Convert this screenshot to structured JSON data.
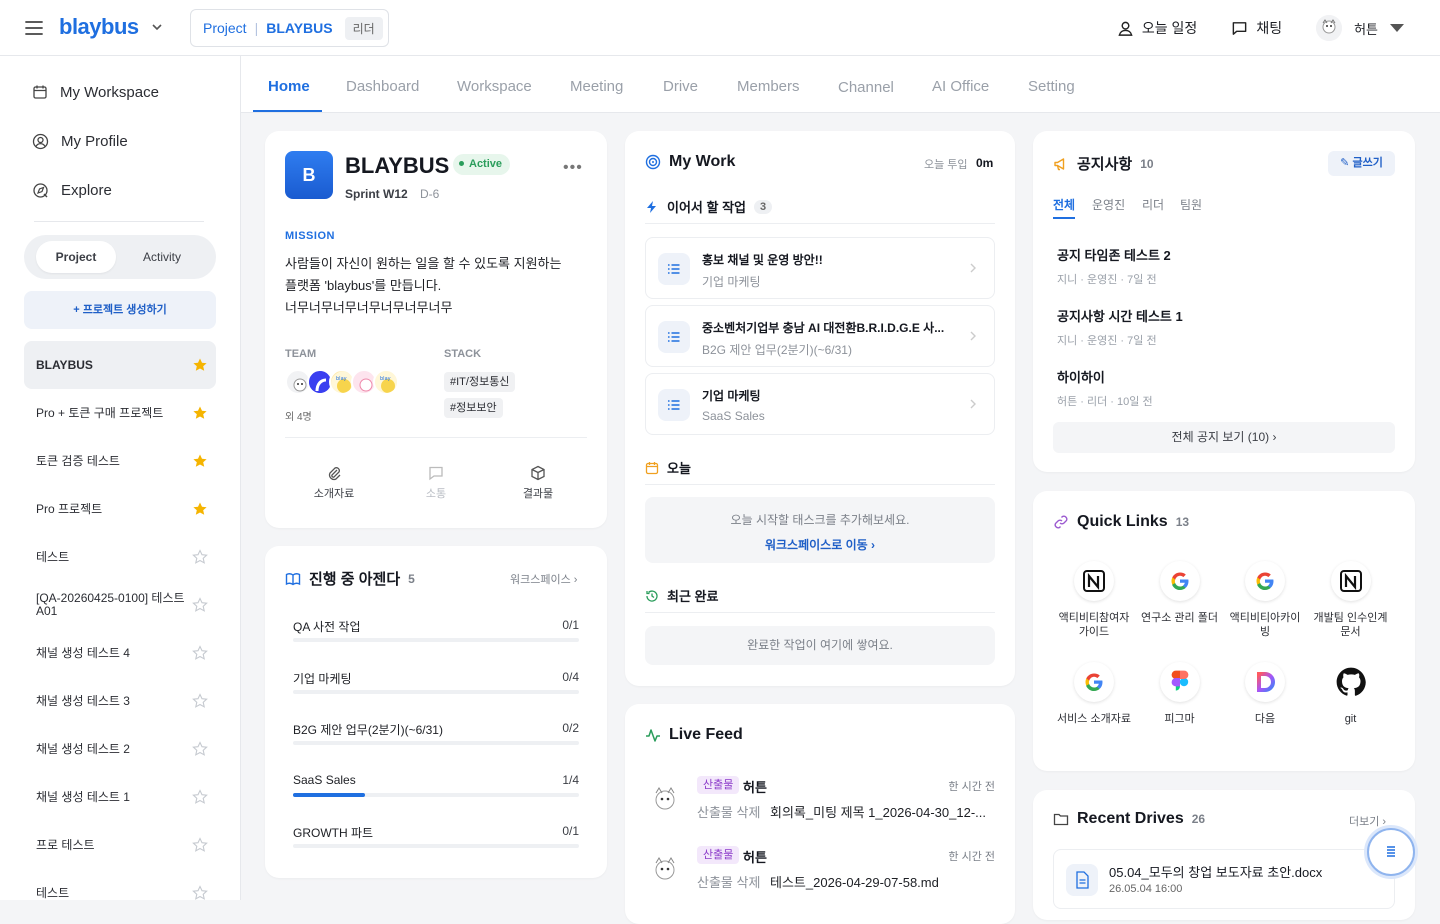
{
  "app": {
    "logo": "blaybus"
  },
  "project_switcher": {
    "prefix": "Project",
    "name": "BLAYBUS",
    "role": "리더"
  },
  "top_actions": {
    "schedule": "오늘 일정",
    "chat": "채팅",
    "user": "허튼"
  },
  "sidebar": {
    "nav": [
      {
        "label": "My Workspace",
        "icon": "calendar-icon"
      },
      {
        "label": "My Profile",
        "icon": "user-circle-icon"
      },
      {
        "label": "Explore",
        "icon": "explore-icon"
      }
    ],
    "segment": {
      "project": "Project",
      "activity": "Activity"
    },
    "create": "+ 프로젝트 생성하기",
    "projects": [
      {
        "name": "BLAYBUS",
        "starred": true
      },
      {
        "name": "Pro + 토큰 구매 프로젝트",
        "starred": true
      },
      {
        "name": "토큰 검증 테스트",
        "starred": true
      },
      {
        "name": "Pro 프로젝트",
        "starred": true
      },
      {
        "name": "테스트",
        "starred": false
      },
      {
        "name": "[QA-20260425-0100] 테스트 A01",
        "starred": false
      },
      {
        "name": "채널 생성 테스트 4",
        "starred": false
      },
      {
        "name": "채널 생성 테스트 3",
        "starred": false
      },
      {
        "name": "채널 생성 테스트 2",
        "starred": false
      },
      {
        "name": "채널 생성 테스트 1",
        "starred": false
      },
      {
        "name": "프로 테스트",
        "starred": false
      },
      {
        "name": "테스트",
        "starred": false
      }
    ]
  },
  "tabs": [
    "Home",
    "Dashboard",
    "Workspace",
    "Meeting",
    "Drive",
    "Members",
    "Channel",
    "AI Office",
    "Setting"
  ],
  "project_card": {
    "badge": "B",
    "name": "BLAYBUS",
    "status": "Active",
    "sprint": "Sprint W12",
    "dday": "D-6",
    "mission_label": "MISSION",
    "mission": "사람들이 자신이 원하는 일을 할 수 있도록 지원하는\n플랫폼 'blaybus'를 만듭니다.\n너무너무너무너무너무너무너무",
    "team_label": "TEAM",
    "team_more": "외 4명",
    "stack_label": "STACK",
    "stack": [
      "#IT/정보통신",
      "#정보보안"
    ],
    "actions": [
      "소개자료",
      "소통",
      "결과물"
    ]
  },
  "agenda": {
    "title": "진행 중 아젠다",
    "count": "5",
    "link": "워크스페이스",
    "items": [
      {
        "name": "QA 사전 작업",
        "value": "0/1",
        "progress": 0
      },
      {
        "name": "기업 마케팅",
        "value": "0/4",
        "progress": 0
      },
      {
        "name": "B2G 제안 업무(2분기)(~6/31)",
        "value": "0/2",
        "progress": 0
      },
      {
        "name": "SaaS Sales",
        "value": "1/4",
        "progress": 0.25
      },
      {
        "name": "GROWTH 파트",
        "value": "0/1",
        "progress": 0
      }
    ]
  },
  "my_work": {
    "title": "My Work",
    "today_label": "오늘 투입",
    "today_value": "0m",
    "next_label": "이어서 할 작업",
    "next_count": "3",
    "next_items": [
      {
        "title": "홍보 채널 및 운영 방안!!",
        "sub": "기업 마케팅"
      },
      {
        "title": "중소벤처기업부 충남 AI 대전환B.R.I.D.G.E 사...",
        "sub": "B2G 제안 업무(2분기)(~6/31)"
      },
      {
        "title": "기업 마케팅",
        "sub": "SaaS Sales"
      }
    ],
    "today_section": "오늘",
    "today_empty": "오늘 시작할 태스크를 추가해보세요.",
    "today_link": "워크스페이스로 이동",
    "recent_label": "최근 완료",
    "recent_empty": "완료한 작업이 여기에 쌓여요."
  },
  "live_feed": {
    "title": "Live Feed",
    "items": [
      {
        "tag": "산출물",
        "user": "허튼",
        "time": "한 시간 전",
        "action": "산출물 삭제",
        "file": "회의록_미팅 제목 1_2026-04-30_12-..."
      },
      {
        "tag": "산출물",
        "user": "허튼",
        "time": "한 시간 전",
        "action": "산출물 삭제",
        "file": "테스트_2026-04-29-07-58.md"
      }
    ]
  },
  "notices": {
    "title": "공지사항",
    "count": "10",
    "write": "글쓰기",
    "tabs": [
      "전체",
      "운영진",
      "리더",
      "팀원"
    ],
    "items": [
      {
        "title": "공지 타임존 테스트 2",
        "meta": "지니 · 운영진 · 7일 전"
      },
      {
        "title": "공지사항 시간 테스트 1",
        "meta": "지니 · 운영진 · 7일 전"
      },
      {
        "title": "하이하이",
        "meta": "허튼 · 리더 · 10일 전"
      }
    ],
    "all": "전체 공지 보기 (10)"
  },
  "quick_links": {
    "title": "Quick Links",
    "count": "13",
    "items": [
      {
        "name": "액티비티참여자가이드",
        "icon": "notion-icon"
      },
      {
        "name": "연구소 관리 폴더",
        "icon": "google-icon"
      },
      {
        "name": "액티비티아카이빙",
        "icon": "google-icon"
      },
      {
        "name": "개발팀 인수인계 문서",
        "icon": "notion-icon"
      },
      {
        "name": "서비스 소개자료",
        "icon": "google-icon"
      },
      {
        "name": "피그마",
        "icon": "figma-icon"
      },
      {
        "name": "다음",
        "icon": "daum-icon"
      },
      {
        "name": "git",
        "icon": "github-icon"
      }
    ]
  },
  "drives": {
    "title": "Recent Drives",
    "count": "26",
    "more": "더보기",
    "file": {
      "name": "05.04_모두의 창업 보도자료 초안.docx",
      "date": "26.05.04 16:00"
    }
  },
  "colors": {
    "accent": "#1f6fe0",
    "active_green": "#2a9d5b",
    "star": "#f5b400",
    "tag_purple": "#8b39c9"
  }
}
